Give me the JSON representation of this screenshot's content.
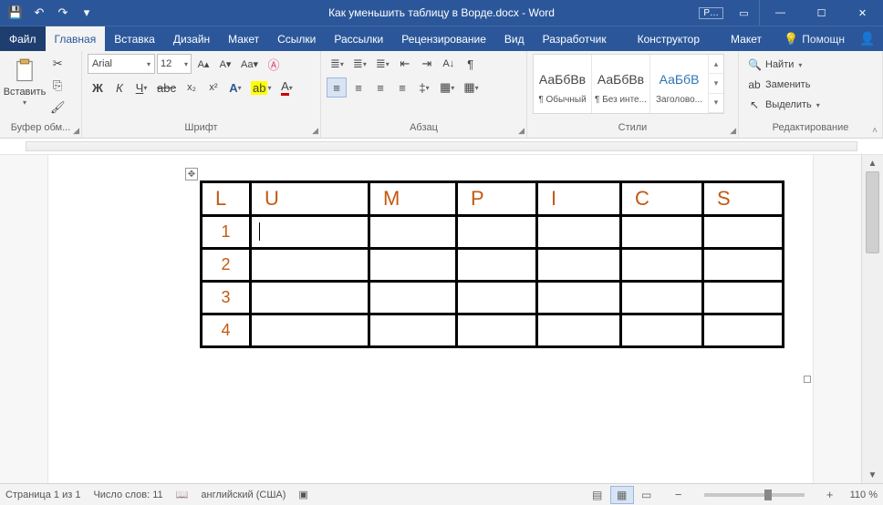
{
  "titlebar": {
    "title": "Как уменьшить таблицу в Ворде.docx - Word",
    "profile_short": "Р…"
  },
  "tabs": {
    "file": "Файл",
    "home": "Главная",
    "insert": "Вставка",
    "design": "Дизайн",
    "layout": "Макет",
    "references": "Ссылки",
    "mailings": "Рассылки",
    "review": "Рецензирование",
    "view": "Вид",
    "developer": "Разработчик",
    "ctx_design": "Конструктор",
    "ctx_layout": "Макет",
    "tell": "Помощн"
  },
  "ribbon": {
    "clipboard": {
      "paste": "Вставить",
      "label": "Буфер обм..."
    },
    "font": {
      "name": "Arial",
      "size": "12",
      "label": "Шрифт"
    },
    "paragraph": {
      "label": "Абзац"
    },
    "styles": {
      "label": "Стили",
      "items": [
        {
          "preview": "АаБбВв",
          "name": "¶ Обычный",
          "color": "#000",
          "weight": "400"
        },
        {
          "preview": "АаБбВв",
          "name": "¶ Без инте...",
          "color": "#000",
          "weight": "400"
        },
        {
          "preview": "АаБбВ",
          "name": "Заголово...",
          "color": "#2E74B5",
          "weight": "400"
        }
      ]
    },
    "editing": {
      "find": "Найти",
      "replace": "Заменить",
      "select": "Выделить",
      "label": "Редактирование"
    }
  },
  "table": {
    "header": [
      "L",
      "U",
      "M",
      "P",
      "I",
      "C",
      "S"
    ],
    "rows": [
      "1",
      "2",
      "3",
      "4"
    ]
  },
  "status": {
    "page": "Страница 1 из 1",
    "words": "Число слов: 11",
    "lang": "английский (США)",
    "zoom": "110 %"
  }
}
